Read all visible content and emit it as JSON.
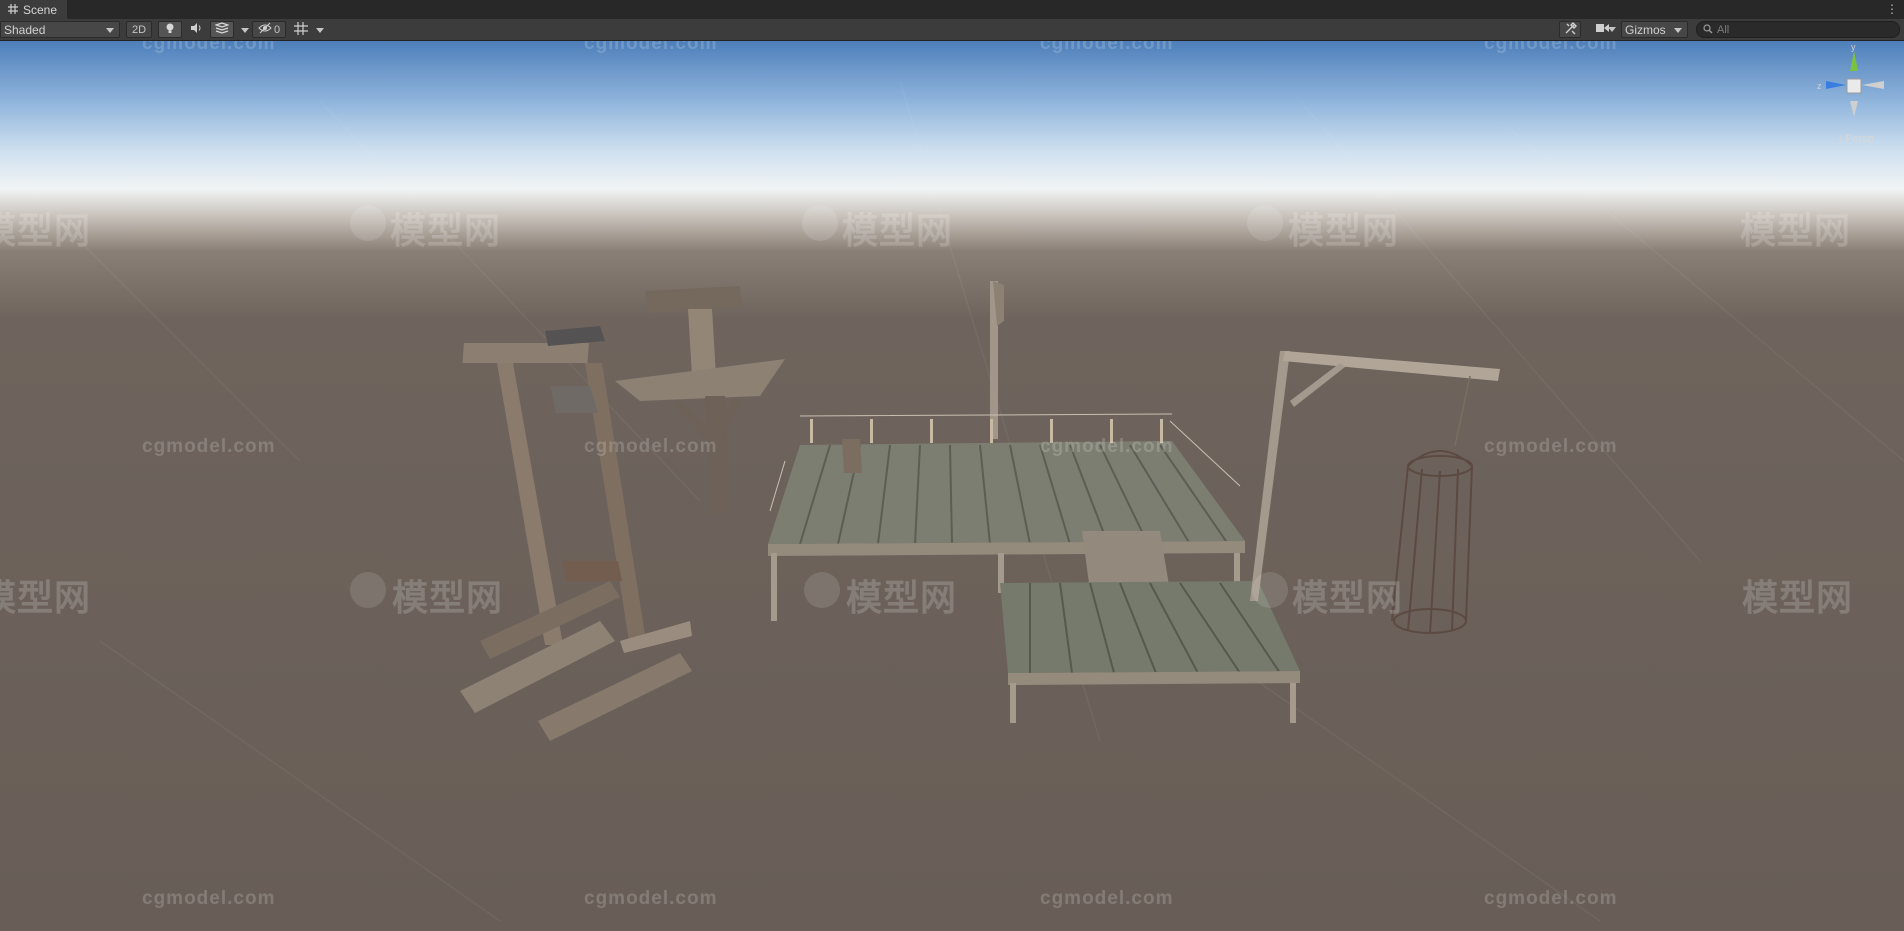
{
  "window": {
    "tab_title": "Scene"
  },
  "toolbar": {
    "draw_mode": "Shaded",
    "two_d_label": "2D",
    "hidden_count": "0",
    "gizmos_label": "Gizmos",
    "search_placeholder": "All"
  },
  "icons": [
    "scene-grid-icon",
    "lighting-icon",
    "audio-icon",
    "effects-icon",
    "visibility-icon",
    "grid-snap-icon",
    "tools-icon",
    "camera-icon",
    "search-icon",
    "kebab-menu-icon"
  ],
  "viewport": {
    "camera_mode": "Persp",
    "gizmo_axes": {
      "y": "y",
      "z": "z"
    },
    "watermarks": [
      "cgmodel.com",
      "模型网"
    ],
    "colors": {
      "sky_top": "#4e7fba",
      "horizon": "#f1f4f5",
      "ground": "#685e57"
    }
  }
}
